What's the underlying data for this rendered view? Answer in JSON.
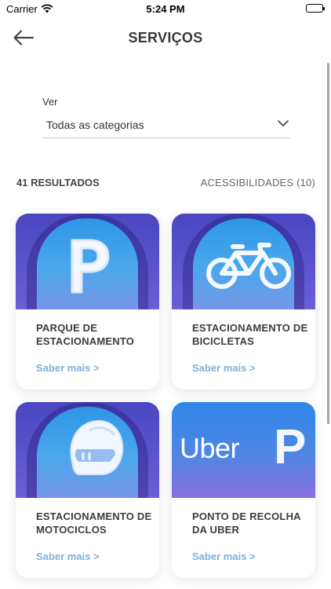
{
  "status_bar": {
    "carrier": "Carrier",
    "time": "5:24 PM"
  },
  "nav": {
    "title": "SERVIÇOS",
    "back_icon": "arrow-left-icon"
  },
  "filter": {
    "label": "Ver",
    "selected": "Todas as categorias",
    "chevron_icon": "chevron-down-icon"
  },
  "results": {
    "count_label": "41 RESULTADOS",
    "accessibility_label": "ACESSIBILIDADES (10)"
  },
  "cards": [
    {
      "title": "PARQUE DE ESTACIONAMENTO",
      "link": "Saber mais >",
      "icon": "parking-icon"
    },
    {
      "title": "ESTACIONAMENTO DE BICICLETAS",
      "link": "Saber mais >",
      "icon": "bicycle-icon"
    },
    {
      "title": "ESTACIONAMENTO DE MOTOCICLOS",
      "link": "Saber mais >",
      "icon": "motorcycle-helmet-icon"
    },
    {
      "title": "PONTO DE RECOLHA DA UBER",
      "link": "Saber mais >",
      "icon": "uber-logo",
      "logo_text": "Uber",
      "logo_mark": "P"
    }
  ],
  "colors": {
    "accent_link": "#7fb0d9",
    "card_bg_top": "#4a46c0",
    "arch_blue": "#2d96e6"
  }
}
